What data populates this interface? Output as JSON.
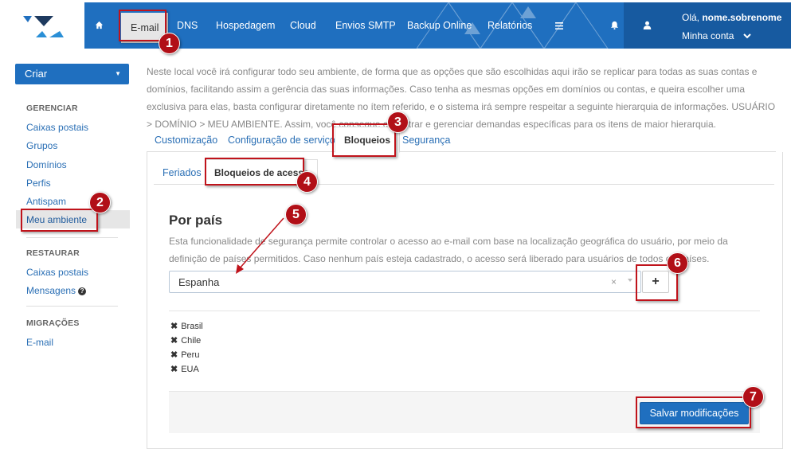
{
  "nav": {
    "home_icon": "home-icon",
    "items": [
      "E-mail",
      "DNS",
      "Hospedagem",
      "Cloud",
      "Envios SMTP",
      "Backup Online",
      "Relatórios"
    ],
    "menu_icon": "hamburger-icon",
    "bell_icon": "bell-icon",
    "user_icon": "user-icon",
    "greeting": "Olá, ",
    "username": "nome.sobrenome",
    "account": "Minha conta",
    "brand_color": "#1f6fbf"
  },
  "sidebar": {
    "create_label": "Criar",
    "manage_heading": "GERENCIAR",
    "manage_items": [
      "Caixas postais",
      "Grupos",
      "Domínios",
      "Perfis",
      "Antispam",
      "Meu ambiente"
    ],
    "restore_heading": "RESTAURAR",
    "restore_items": [
      "Caixas postais",
      "Mensagens"
    ],
    "migrations_heading": "MIGRAÇÕES",
    "migrations_items": [
      "E-mail"
    ]
  },
  "main": {
    "intro": "Neste local você irá configurar todo seu ambiente, de forma que as opções que são escolhidas aqui irão se replicar para todas as suas contas e domínios, facilitando assim a gerência das suas informações. Caso tenha as mesmas opções em domínios ou contas, e queira escolher uma exclusiva para elas, basta configurar diretamente no ítem referido, e o sistema irá sempre respeitar a seguinte hierarquia de informações. USUÁRIO > DOMÍNIO > MEU AMBIENTE. Assim, você consegue cadastrar e gerenciar demandas específicas para os itens de maior hierarquia.",
    "tabs": [
      "Customização",
      "Configuração de serviços",
      "Bloqueios",
      "Segurança"
    ],
    "subtabs": [
      "Feriados",
      "Bloqueios de acesso"
    ],
    "section_title": "Por país",
    "section_desc": "Esta funcionalidade de segurança permite controlar o acesso ao e-mail com base na localização geográfica do usuário, por meio da definição de países permitidos. Caso nenhum país esteja cadastrado, o acesso será liberado para usuários de todos os países.",
    "select_value": "Espanha",
    "add_label": "+",
    "countries": [
      "Brasil",
      "Chile",
      "Peru",
      "EUA"
    ],
    "save_label": "Salvar modificações"
  },
  "annotations": [
    "1",
    "2",
    "3",
    "4",
    "5",
    "6",
    "7"
  ]
}
